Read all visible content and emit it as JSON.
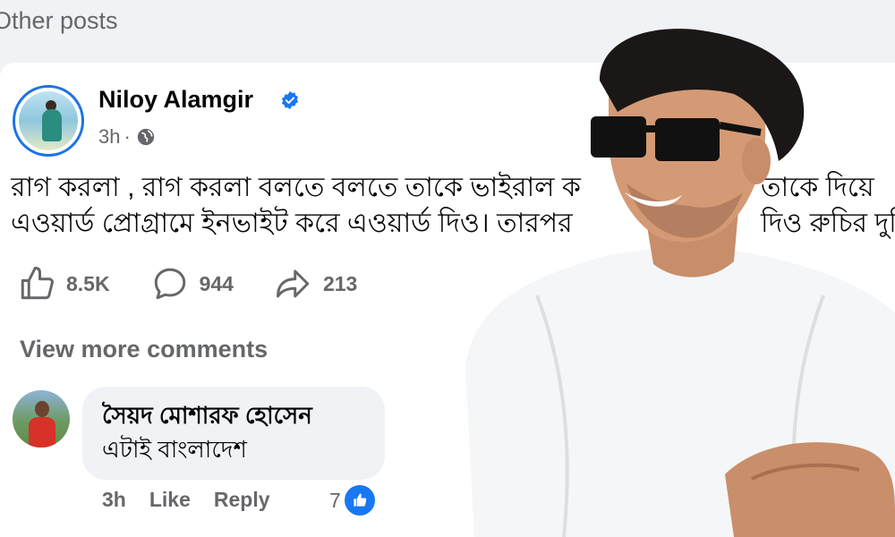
{
  "section": {
    "title": "Other posts"
  },
  "post": {
    "author": "Niloy Alamgir",
    "verified": true,
    "time": "3h",
    "separator": "·",
    "privacy_icon": "globe-icon",
    "text_line_1": "রাগ করলা , রাগ করলা বলতে বলতে তাকে ভাইরাল ক",
    "text_line_2": "এওয়ার্ড প্রোগ্রামে ইনভাইট করে এওয়ার্ড দিও। তারপর",
    "text_fragment_right_1": "তাকে দিয়ে",
    "text_fragment_right_2": "দিও রুচির দুর্ভি",
    "likes": "8.5K",
    "comments": "944",
    "shares": "213"
  },
  "comments_section": {
    "view_more": "View more comments",
    "comment": {
      "author": "সৈয়দ মোশারফ হোসেন",
      "text": "এটাই বাংলাদেশ",
      "time": "3h",
      "like_label": "Like",
      "reply_label": "Reply",
      "reaction_count": "7"
    }
  },
  "colors": {
    "accent": "#1877f2",
    "secondary_text": "#65676b",
    "background": "#f0f2f5"
  }
}
